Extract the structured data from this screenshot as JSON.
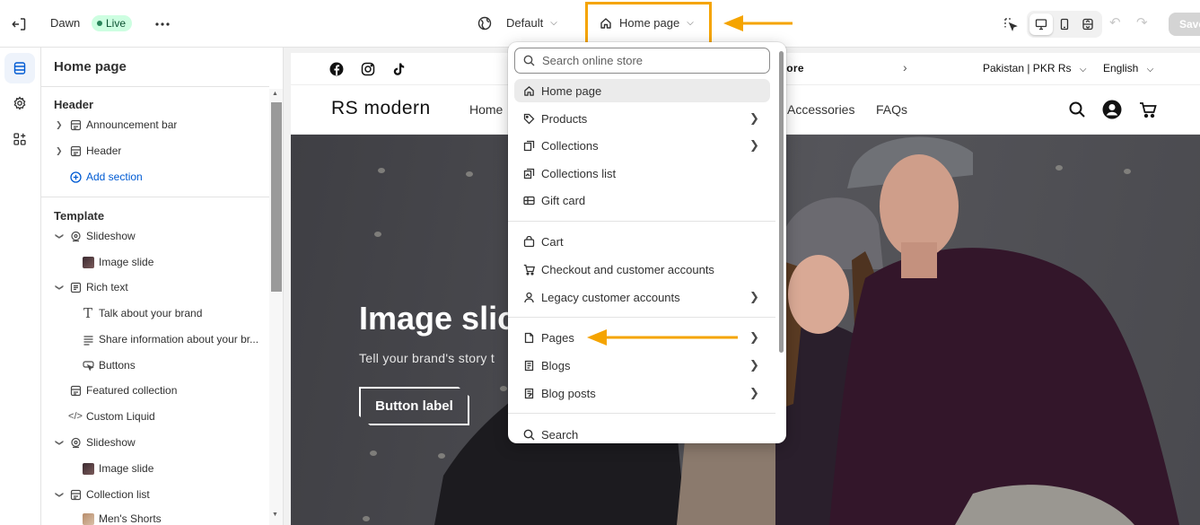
{
  "topbar": {
    "theme_name": "Dawn",
    "live_badge": "Live",
    "theme_select": "Default",
    "page_select": "Home page"
  },
  "topbar_buttons": {
    "save": "Save"
  },
  "sidebar": {
    "title": "Home page",
    "header_group": "Header",
    "header_items": [
      {
        "label": "Announcement bar",
        "icon": "section-icon"
      },
      {
        "label": "Header",
        "icon": "section-icon"
      }
    ],
    "add_section": "Add section",
    "template_group": "Template",
    "template_items": [
      {
        "label": "Slideshow",
        "level": 0
      },
      {
        "label": "Image slide",
        "level": 1
      },
      {
        "label": "Rich text",
        "level": 0
      },
      {
        "label": "Talk about your brand",
        "level": 1
      },
      {
        "label": "Share information about your br...",
        "level": 1
      },
      {
        "label": "Buttons",
        "level": 1
      },
      {
        "label": "Featured collection",
        "level": 0
      },
      {
        "label": "Custom Liquid",
        "level": 0
      },
      {
        "label": "Slideshow",
        "level": 0
      },
      {
        "label": "Image slide",
        "level": 1
      },
      {
        "label": "Collection list",
        "level": 0
      },
      {
        "label": "Men's Shorts",
        "level": 1
      }
    ]
  },
  "store": {
    "announcement": "tore",
    "country": "Pakistan | PKR Rs",
    "language": "English",
    "logo": "RS modern",
    "nav": [
      "Home",
      "Accessories",
      "FAQs"
    ],
    "hero_title": "Image slic",
    "hero_subtitle": "Tell your brand's story t",
    "hero_button": "Button label"
  },
  "dropdown": {
    "search_placeholder": "Search online store",
    "items": [
      {
        "label": "Home page",
        "icon": "home-icon",
        "chevron": false,
        "selected": true
      },
      {
        "label": "Products",
        "icon": "tag-icon",
        "chevron": true
      },
      {
        "label": "Collections",
        "icon": "collection-icon",
        "chevron": true
      },
      {
        "label": "Collections list",
        "icon": "collections-list-icon",
        "chevron": false
      },
      {
        "label": "Gift card",
        "icon": "gift-card-icon",
        "chevron": false
      },
      {
        "label": "Cart",
        "icon": "cart-bag-icon",
        "chevron": false
      },
      {
        "label": "Checkout and customer accounts",
        "icon": "checkout-cart-icon",
        "chevron": false
      },
      {
        "label": "Legacy customer accounts",
        "icon": "person-icon",
        "chevron": true
      },
      {
        "label": "Pages",
        "icon": "page-icon",
        "chevron": true
      },
      {
        "label": "Blogs",
        "icon": "blog-icon",
        "chevron": true
      },
      {
        "label": "Blog posts",
        "icon": "blog-post-icon",
        "chevron": true
      },
      {
        "label": "Search",
        "icon": "search-icon",
        "chevron": false
      }
    ]
  },
  "colors": {
    "highlight": "#f5a400",
    "live_bg": "#cdfee1",
    "live_text": "#0c5132",
    "link_blue": "#005bd3"
  }
}
